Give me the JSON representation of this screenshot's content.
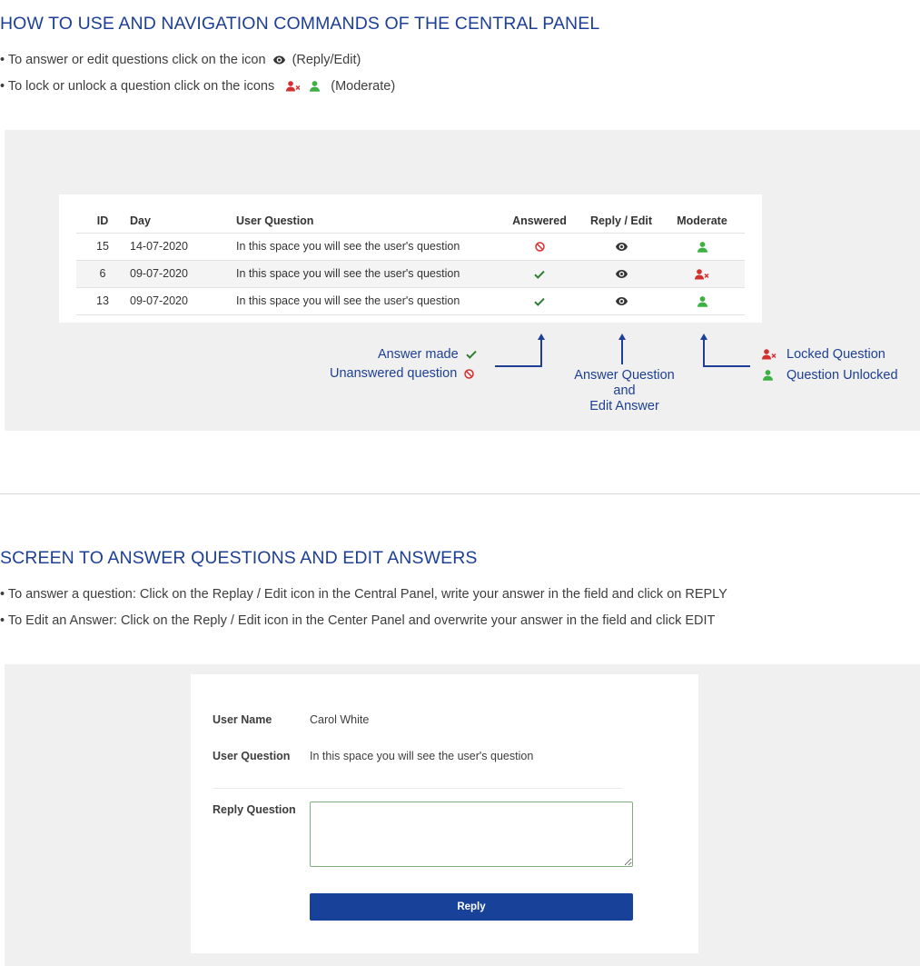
{
  "section1": {
    "title": "HOW TO USE AND NAVIGATION COMMANDS OF THE CENTRAL PANEL",
    "bullet1_text": "• To answer or edit questions click on the icon",
    "bullet1_suffix": "(Reply/Edit)",
    "bullet2_text": "• To lock or unlock a question click on the icons",
    "bullet2_suffix": "(Moderate)"
  },
  "table": {
    "columns": [
      "ID",
      "Day",
      "User Question",
      "Answered",
      "Reply / Edit",
      "Moderate"
    ],
    "rows": [
      {
        "id": "15",
        "day": "14-07-2020",
        "question": "In this space you will see the user's question",
        "answered": "unanswered",
        "moderate": "unlocked"
      },
      {
        "id": "6",
        "day": "09-07-2020",
        "question": "In this space you will see the user's question",
        "answered": "answered",
        "moderate": "locked"
      },
      {
        "id": "13",
        "day": "09-07-2020",
        "question": "In this space you will see the user's question",
        "answered": "answered",
        "moderate": "unlocked"
      }
    ]
  },
  "annotations": {
    "answer_made": "Answer made",
    "unanswered_question": "Unanswered question",
    "reply_edit_line1": "Answer Question",
    "reply_edit_line2": "and",
    "reply_edit_line3": "Edit Answer",
    "locked_question": "Locked Question",
    "question_unlocked": "Question Unlocked"
  },
  "section2": {
    "title": "SCREEN TO ANSWER QUESTIONS AND EDIT ANSWERS",
    "bullet1": "• To answer a question: Click on the Replay / Edit icon in the Central Panel, write your answer in the field and click on REPLY",
    "bullet2": "• To Edit an Answer: Click on the Reply / Edit icon in the Center Panel and overwrite your answer in the field and click EDIT"
  },
  "form": {
    "user_name_label": "User Name",
    "user_name_value": "Carol White",
    "user_question_label": "User Question",
    "user_question_value": "In this space you will see the user's question",
    "reply_question_label": "Reply Question",
    "reply_textarea_value": "",
    "reply_button_label": "Reply"
  },
  "colors": {
    "heading_blue": "#1d3f95",
    "button_blue": "#18429a",
    "answered_green": "#2e7d32",
    "unanswered_red": "#d32f2f",
    "unlocked_green": "#3cb043",
    "locked_red": "#d32f2f",
    "panel_gray": "#f0f0f0"
  },
  "icons": {
    "reply_edit": "eye-icon",
    "answered": "check-icon",
    "unanswered": "ban-icon",
    "unlocked": "user-icon",
    "locked": "user-times-icon"
  }
}
